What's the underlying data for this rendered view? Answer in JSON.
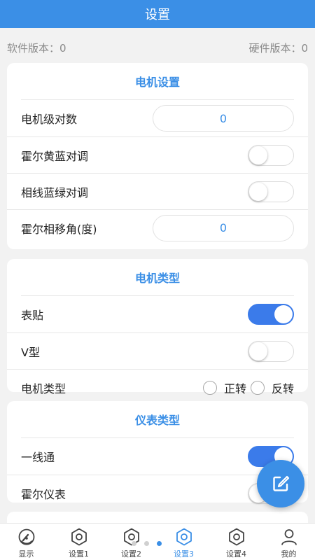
{
  "header": {
    "title": "设置"
  },
  "versions": {
    "software": "软件版本：0",
    "hardware": "硬件版本：0"
  },
  "motor_settings": {
    "title": "电机设置",
    "pole_pairs": {
      "label": "电机级对数",
      "value": "0"
    },
    "hall_yellow_blue": {
      "label": "霍尔黄蓝对调",
      "on": false
    },
    "phase_blue_green": {
      "label": "相线蓝绿对调",
      "on": false
    },
    "hall_phase_angle": {
      "label": "霍尔相移角(度)",
      "value": "0"
    }
  },
  "motor_type": {
    "title": "电机类型",
    "surface": {
      "label": "表贴",
      "on": true
    },
    "v_type": {
      "label": "V型",
      "on": false
    },
    "direction": {
      "label": "电机类型",
      "forward": "正转",
      "reverse": "反转"
    }
  },
  "meter_type": {
    "title": "仪表类型",
    "one_wire": {
      "label": "一线通",
      "on": true
    },
    "hall_meter": {
      "label": "霍尔仪表",
      "on": false
    }
  },
  "tabs": [
    {
      "label": "显示",
      "icon": "speedometer-icon"
    },
    {
      "label": "设置1",
      "icon": "hex-nut-icon"
    },
    {
      "label": "设置2",
      "icon": "hex-nut-icon"
    },
    {
      "label": "设置3",
      "icon": "hex-nut-icon",
      "active": true
    },
    {
      "label": "设置4",
      "icon": "hex-nut-icon"
    },
    {
      "label": "我的",
      "icon": "user-icon"
    }
  ],
  "page_indicator": {
    "count": 3,
    "current": 3
  },
  "colors": {
    "accent": "#3b8fe6",
    "toggle_on": "#3b7bea"
  }
}
